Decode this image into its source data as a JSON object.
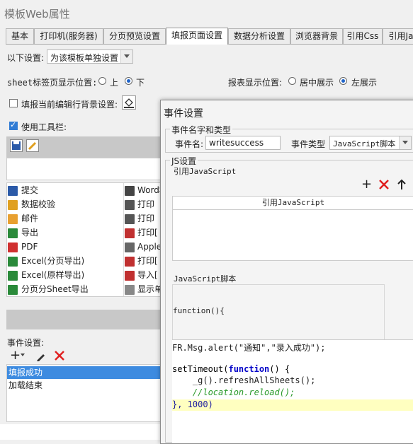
{
  "window": {
    "title": "模板Web属性"
  },
  "tabs": [
    "基本",
    "打印机(服务器)",
    "分页预览设置",
    "填报页面设置",
    "数据分析设置",
    "浏览器背景",
    "引用Css",
    "引用Ja"
  ],
  "settings": {
    "following_label": "以下设置:",
    "following_value": "为该模板单独设置",
    "sheet_pos_label": "sheet标签页显示位置:",
    "sheet_pos_up": "上",
    "sheet_pos_down": "下",
    "report_pos_label": "报表显示位置:",
    "report_pos_center": "居中展示",
    "report_pos_left": "左展示",
    "fill_bg_label": "填报当前编辑行背景设置:",
    "use_toolbar_label": "使用工具栏:"
  },
  "toolbar_buttons_left": [
    "提交",
    "数据校验",
    "邮件",
    "导出",
    "PDF",
    "Excel(分页导出)",
    "Excel(原样导出)",
    "分页分Sheet导出"
  ],
  "toolbar_buttons_right": [
    "Word格",
    "打印",
    "打印",
    "打印[",
    "Apple",
    "打印[",
    "导入[",
    "显示单"
  ],
  "events": {
    "label": "事件设置:",
    "items": [
      "填报成功",
      "加载结束"
    ],
    "selected_index": 0
  },
  "dialog": {
    "title": "事件设置",
    "name_type_group": "事件名字和类型",
    "event_name_label": "事件名:",
    "event_name_value": "writesuccess",
    "event_type_label": "事件类型",
    "event_type_value": "JavaScript脚本",
    "js_group": "JS设置",
    "ref_js_label": "引用JavaScript",
    "ref_js_header": "引用JavaScript",
    "js_script_label": "JavaScript脚本",
    "function_open": "function(){",
    "code_lines": [
      "FR.Msg.alert(\"通知\",\"录入成功\");",
      "",
      "setTimeout(function() {",
      "    _g().refreshAllSheets();",
      "    //location.reload();",
      "}, 1000)"
    ]
  },
  "colors": {
    "accent": "#2f7bd4",
    "selection": "#3d8be0",
    "highlight_line": "#ffffc0",
    "delete_red": "#e02020"
  }
}
